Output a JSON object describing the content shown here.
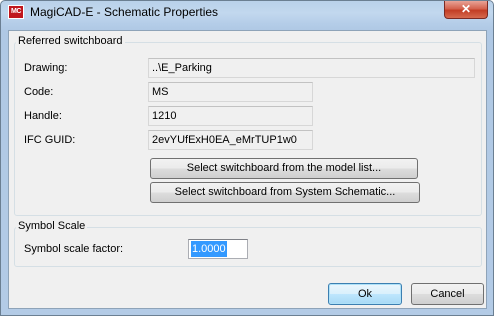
{
  "window": {
    "app_icon_text": "MC",
    "title": "MagiCAD-E - Schematic Properties",
    "close_glyph": "✕"
  },
  "referred_switchboard": {
    "group_title": "Referred switchboard",
    "drawing_label": "Drawing:",
    "drawing_value": "..\\E_Parking",
    "code_label": "Code:",
    "code_value": "MS",
    "handle_label": "Handle:",
    "handle_value": "1210",
    "ifc_guid_label": "IFC GUID:",
    "ifc_guid_value": "2evYUfExH0EA_eMrTUP1w0",
    "select_model_list_button": "Select switchboard from the model list...",
    "select_system_schematic_button": "Select switchboard from System Schematic..."
  },
  "symbol_scale": {
    "group_title": "Symbol Scale",
    "factor_label": "Symbol scale factor:",
    "factor_value": "1.0000"
  },
  "footer": {
    "ok_label": "Ok",
    "cancel_label": "Cancel"
  },
  "colors": {
    "titlebar": "#b9d1ea",
    "close_button": "#c8452c",
    "dialog_background": "#f0f0f0",
    "selection": "#3399ff"
  },
  "icons": {
    "app": "magicad-logo-icon",
    "close": "close-icon"
  }
}
